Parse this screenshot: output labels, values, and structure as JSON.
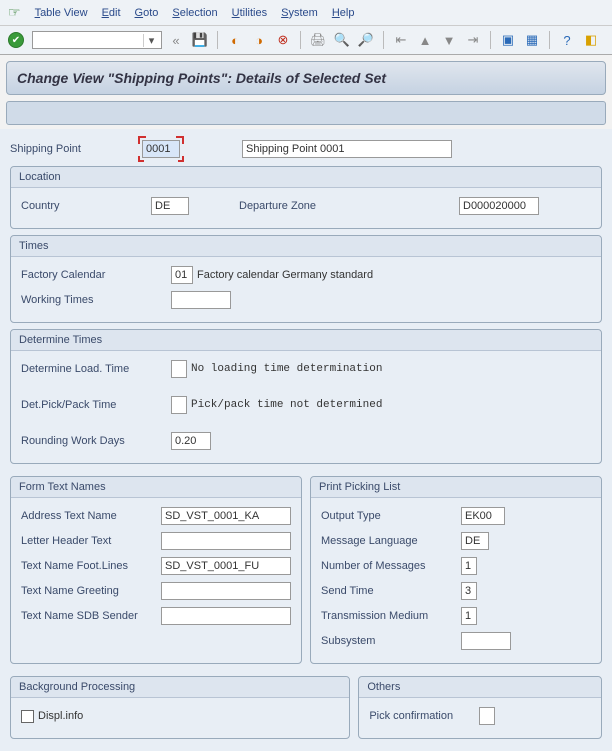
{
  "menu": {
    "items": [
      {
        "u": "T",
        "rest": "able View"
      },
      {
        "u": "E",
        "rest": "dit"
      },
      {
        "u": "G",
        "rest": "oto"
      },
      {
        "u": "S",
        "rest": "election"
      },
      {
        "u": "U",
        "rest": "tilities"
      },
      {
        "u": "S",
        "rest": "ystem"
      },
      {
        "u": "H",
        "rest": "elp"
      }
    ]
  },
  "title": "Change View \"Shipping Points\": Details of Selected Set",
  "shipping_point": {
    "label": "Shipping Point",
    "code": "0001",
    "desc": "Shipping Point 0001"
  },
  "location": {
    "title": "Location",
    "country_label": "Country",
    "country": "DE",
    "depzone_label": "Departure Zone",
    "depzone": "D000020000"
  },
  "times": {
    "title": "Times",
    "factcal_label": "Factory Calendar",
    "factcal": "01",
    "factcal_desc": "Factory calendar Germany standard",
    "work_label": "Working Times",
    "work": ""
  },
  "det": {
    "title": "Determine Times",
    "load_label": "Determine Load. Time",
    "load": "",
    "load_desc": "No loading time determination",
    "pick_label": "Det.Pick/Pack Time",
    "pick": "",
    "pick_desc": "Pick/pack time not determined",
    "round_label": "Rounding Work Days",
    "round": "0.20"
  },
  "form": {
    "title": "Form Text Names",
    "addr_label": "Address Text Name",
    "addr": "SD_VST_0001_KA",
    "header_label": "Letter Header Text",
    "header": "",
    "foot_label": "Text Name Foot.Lines",
    "foot": "SD_VST_0001_FU",
    "greet_label": "Text Name Greeting",
    "greet": "",
    "sdb_label": "Text Name SDB Sender",
    "sdb": ""
  },
  "print": {
    "title": "Print Picking List",
    "out_label": "Output Type",
    "out": "EK00",
    "lang_label": "Message Language",
    "lang": "DE",
    "num_label": "Number of Messages",
    "num": "1",
    "send_label": "Send Time",
    "send": "3",
    "trans_label": "Transmission Medium",
    "trans": "1",
    "sub_label": "Subsystem",
    "sub": ""
  },
  "bg": {
    "title": "Background Processing",
    "displ": "Displ.info"
  },
  "others": {
    "title": "Others",
    "pick": "Pick confirmation",
    "pick_val": ""
  }
}
